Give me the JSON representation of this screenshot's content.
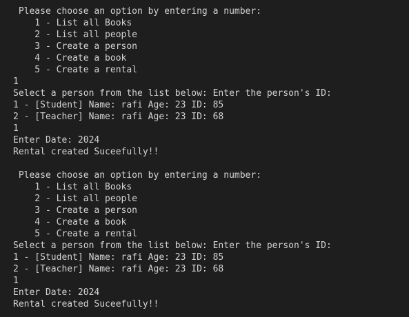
{
  "terminal": {
    "lines": [
      " Please choose an option by entering a number:",
      "    1 - List all Books",
      "    2 - List all people",
      "    3 - Create a person",
      "    4 - Create a book",
      "    5 - Create a rental",
      "1",
      "Select a person from the list below: Enter the person's ID:",
      "1 - [Student] Name: rafi Age: 23 ID: 85",
      "2 - [Teacher] Name: rafi Age: 23 ID: 68",
      "1",
      "Enter Date: 2024",
      "Rental created Suceefully!!",
      "",
      " Please choose an option by entering a number:",
      "    1 - List all Books",
      "    2 - List all people",
      "    3 - Create a person",
      "    4 - Create a book",
      "    5 - Create a rental",
      "Select a person from the list below: Enter the person's ID:",
      "1 - [Student] Name: rafi Age: 23 ID: 85",
      "2 - [Teacher] Name: rafi Age: 23 ID: 68",
      "1",
      "Enter Date: 2024",
      "Rental created Suceefully!!"
    ]
  }
}
